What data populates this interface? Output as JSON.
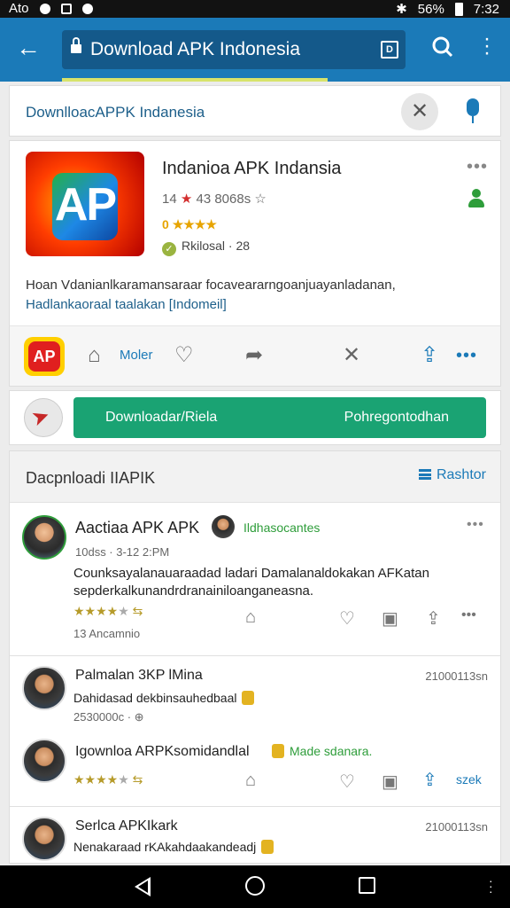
{
  "status_bar": {
    "left_text": "Ato",
    "signal_text": "56%",
    "time": "7:32"
  },
  "toolbar": {
    "url": "Download APK Indonesia",
    "tab_icon_label": "D"
  },
  "search": {
    "query": "DownlloacAPPK Indanesia"
  },
  "app": {
    "name": "Indanioa APK Indansia",
    "meta": "43 8068s",
    "meta_prefix": "14",
    "stars_prefix": "0",
    "stars": "★★★★",
    "label": "Rkilosal · 28",
    "desc_line1": "Hoan Vdanianlkaramansaraar focaveararngoanjuayanladanan,",
    "desc_line2": "Hadlankaoraal taalakan [Indomeil]",
    "small_icon_text": "AP",
    "action_label": "Moler"
  },
  "download": {
    "left_label": "Downloadar/Riela",
    "right_label": "Pohregontodhan"
  },
  "comments_section": {
    "title": "Dacpnloadi IIAPIK",
    "sort_label": "Rashtor",
    "items": [
      {
        "name": "Aactiaa APK APK",
        "tag": "Ildhasocantes",
        "meta": "10dss · 3-12 2:PM",
        "body": "Counksayalanauaraadad ladari Damalanaldokakan AFKatan sepderkalkunandrdranainiloanganeasna.",
        "stars": "★★★★",
        "star_empty": "★",
        "count": "13 Ancamnio"
      },
      {
        "name": "Palmalan 3KP lMina",
        "date": "21000113sn",
        "body": "Dahidasad dekbinsauhedbaal",
        "meta": "2530000c"
      },
      {
        "name": "Igownloa ARPKsomidandlal",
        "tag": "Made sdanara.",
        "stars": "★★★★",
        "star_empty": "★",
        "right_label": "szek"
      },
      {
        "name": "Serlca APKIkark",
        "date": "21000113sn",
        "body": "Nenakaraad rKAkahdaakandeadj"
      }
    ]
  },
  "colors": {
    "toolbar": "#1b7ab8",
    "accent_green": "#1aa373",
    "link_blue": "#1d5f8a"
  }
}
